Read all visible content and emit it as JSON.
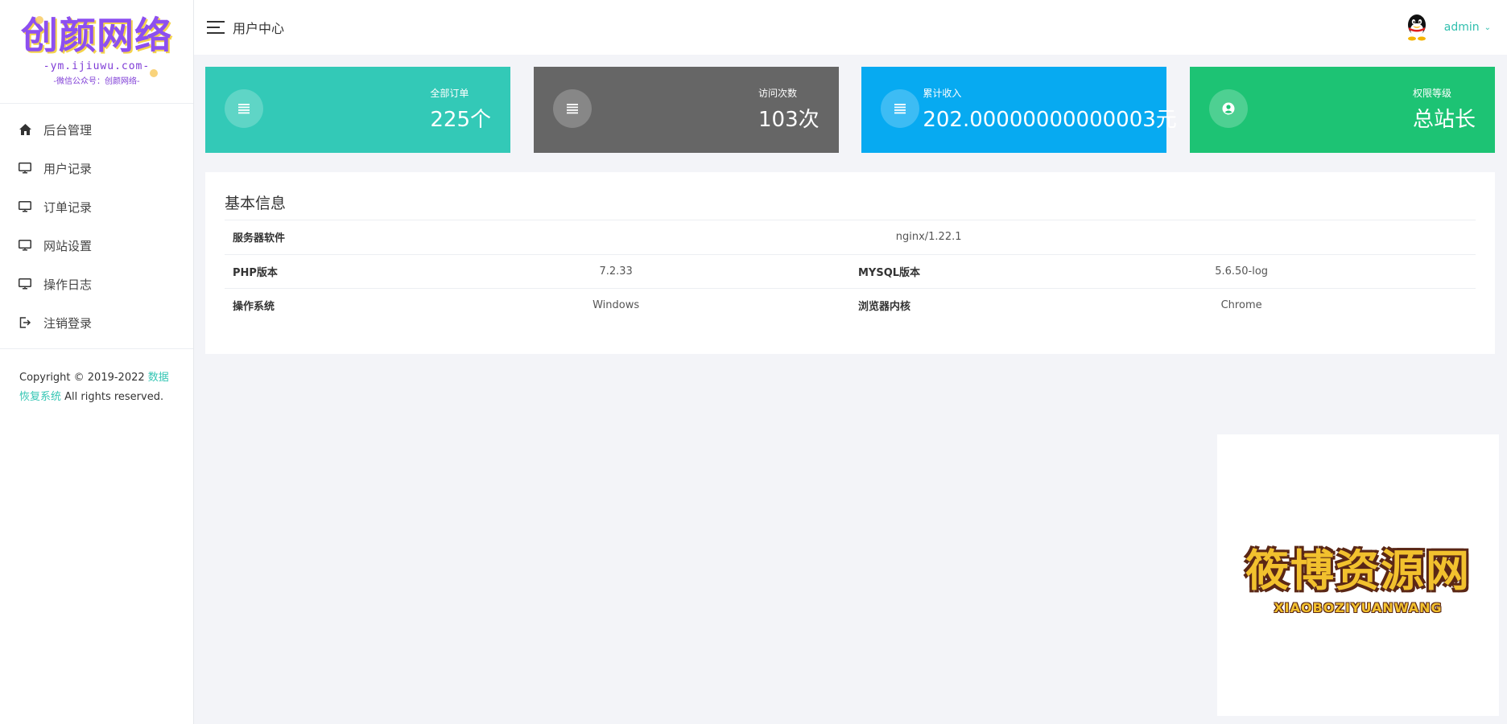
{
  "logo": {
    "title": "创颜网络",
    "line1": "-ym.ijiuwu.com-",
    "line2": "-微信公众号：创颜网络-"
  },
  "sidebar": {
    "items": [
      {
        "label": "后台管理",
        "icon": "home-icon"
      },
      {
        "label": "用户记录",
        "icon": "monitor-icon"
      },
      {
        "label": "订单记录",
        "icon": "monitor-icon"
      },
      {
        "label": "网站设置",
        "icon": "monitor-icon"
      },
      {
        "label": "操作日志",
        "icon": "monitor-icon"
      },
      {
        "label": "注销登录",
        "icon": "logout-icon"
      }
    ],
    "copyright_prefix": "Copyright © 2019-2022 ",
    "copyright_link": "数据恢复系统",
    "copyright_suffix": " All rights reserved."
  },
  "header": {
    "title": "用户中心",
    "user": "admin"
  },
  "cards": [
    {
      "label": "全部订单",
      "value": "225个",
      "color": "#33c9b7",
      "icon": "list-icon"
    },
    {
      "label": "访问次数",
      "value": "103次",
      "color": "#666666",
      "icon": "list-icon"
    },
    {
      "label": "累计收入",
      "value": "202.00000000000003元",
      "color": "#07aaf1",
      "icon": "list-icon"
    },
    {
      "label": "权限等级",
      "value": "总站长",
      "color": "#1dc374",
      "icon": "user-circle-icon"
    }
  ],
  "panel": {
    "title": "基本信息",
    "server_label": "服务器软件",
    "server_value": "nginx/1.22.1",
    "php_label": "PHP版本",
    "php_value": "7.2.33",
    "mysql_label": "MYSQL版本",
    "mysql_value": "5.6.50-log",
    "os_label": "操作系统",
    "os_value": "Windows",
    "browser_label": "浏览器内核",
    "browser_value": "Chrome"
  },
  "watermark": {
    "title": "筱博资源网",
    "subtitle": "XIAOBOZIYUANWANG"
  }
}
